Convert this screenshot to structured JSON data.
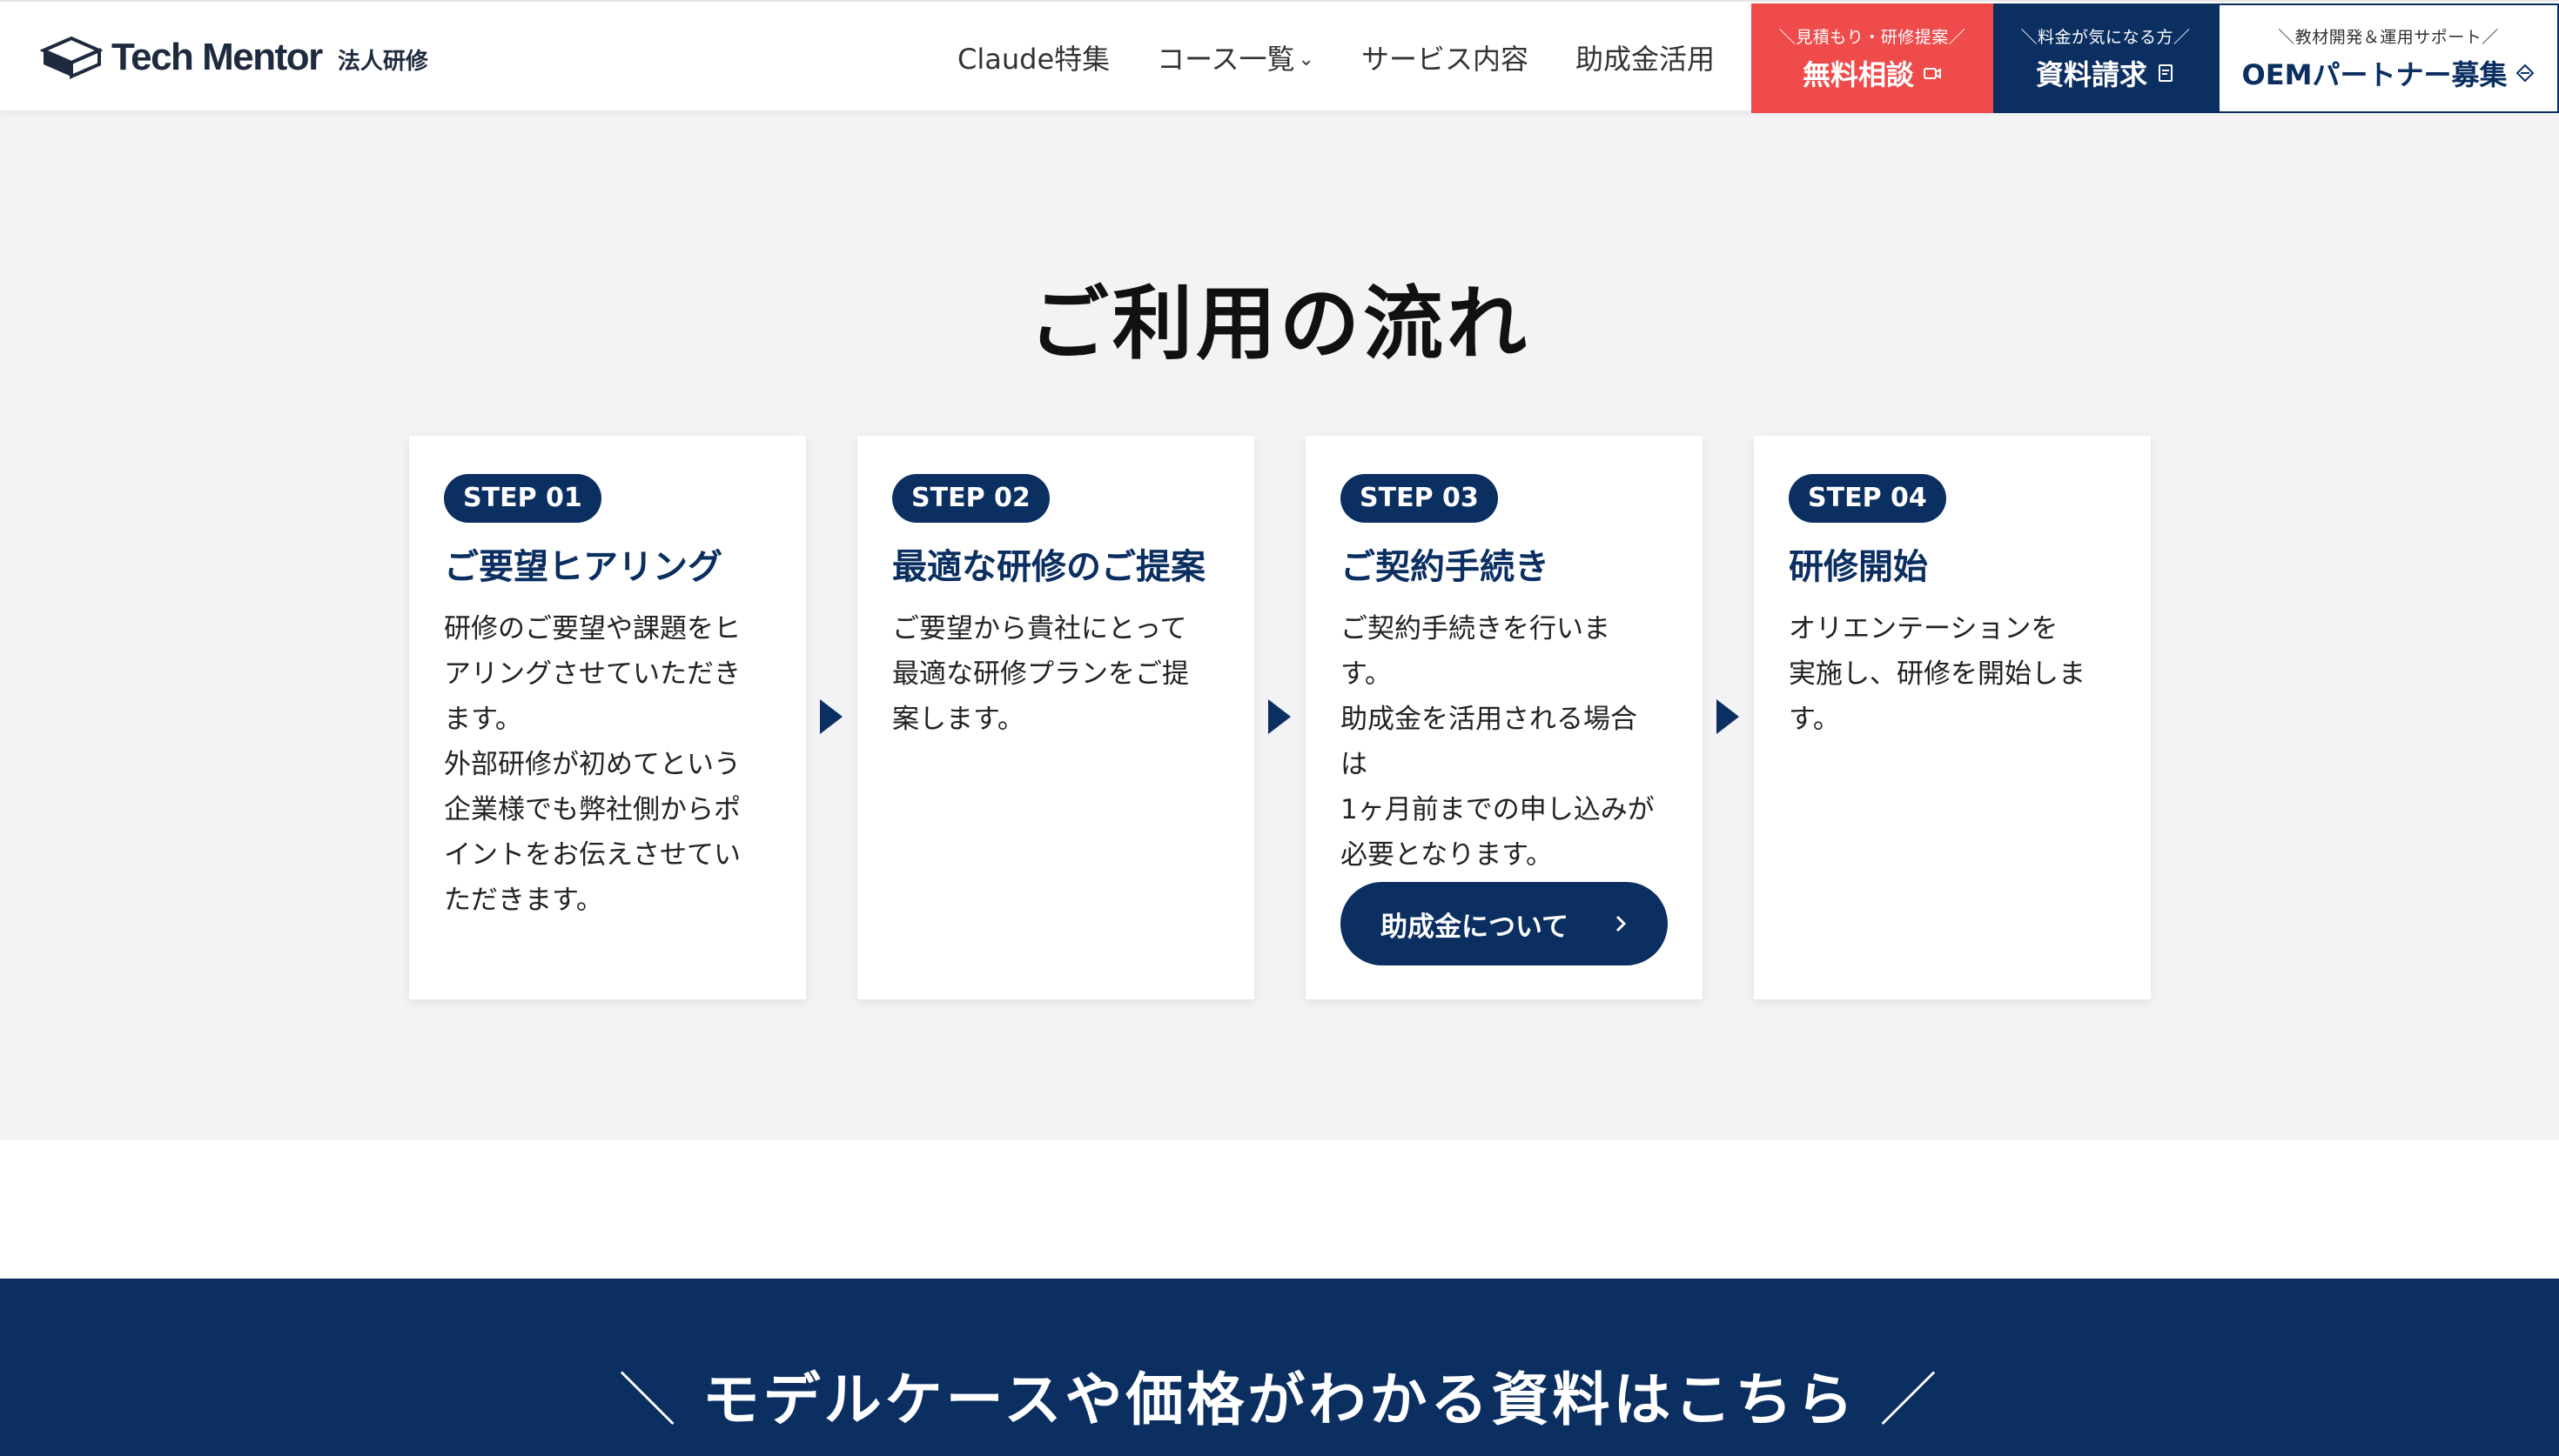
{
  "header": {
    "logo_name": "Tech Mentor",
    "logo_sub": "法人研修",
    "nav": [
      {
        "label": "Claude特集"
      },
      {
        "label": "コース一覧",
        "has_dropdown": true
      },
      {
        "label": "サービス内容"
      },
      {
        "label": "助成金活用"
      }
    ],
    "consult": {
      "small": "＼見積もり・研修提案／",
      "label": "無料相談"
    },
    "docs": {
      "small": "＼料金が気になる方／",
      "label": "資料請求"
    },
    "oem": {
      "small": "＼教材開発＆運用サポート／",
      "label": "OEMパートナー募集"
    }
  },
  "flow": {
    "title": "ご利用の流れ",
    "steps": [
      {
        "badge": "STEP 01",
        "title": "ご要望ヒアリング",
        "lines": [
          "研修のご要望や課題をヒ",
          "アリングさせていただき",
          "ます。",
          "外部研修が初めてという",
          "企業様でも弊社側からポ",
          "イントをお伝えさせてい",
          "ただきます。"
        ]
      },
      {
        "badge": "STEP 02",
        "title": "最適な研修のご提案",
        "lines": [
          "ご要望から貴社にとって",
          "最適な研修プランをご提",
          "案します。"
        ]
      },
      {
        "badge": "STEP 03",
        "title": "ご契約手続き",
        "lines": [
          "ご契約手続きを行いま",
          "す。",
          "助成金を活用される場合",
          "は",
          "1ヶ月前までの申し込みが",
          "必要となります。"
        ],
        "cta": "助成金について",
        "cta_icon": "chevron-right-icon"
      },
      {
        "badge": "STEP 04",
        "title": "研修開始",
        "lines": [
          "オリエンテーションを",
          "実施し、研修を開始しま",
          "す。"
        ]
      }
    ]
  },
  "banner": {
    "slash_left": "＼",
    "text": "モデルケースや価格がわかる資料はこちら",
    "slash_right": "／"
  },
  "colors": {
    "navy": "#0b2f61",
    "red": "#ef4b4b",
    "section_bg": "#f3f3f5"
  }
}
